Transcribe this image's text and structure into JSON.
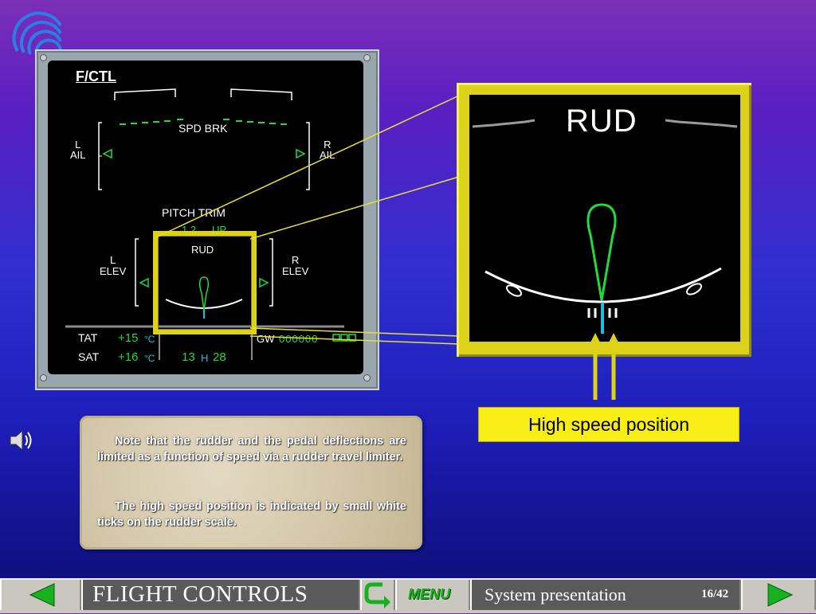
{
  "ecam": {
    "title": "F/CTL",
    "spd_brk": "SPD BRK",
    "l_ail_1": "L",
    "l_ail_2": "AIL",
    "r_ail_1": "R",
    "r_ail_2": "AIL",
    "pitch_trim": "PITCH TRIM",
    "pitch_value": "1.2",
    "pitch_dir": "UP",
    "rud": "RUD",
    "l_elev_1": "L",
    "l_elev_2": "ELEV",
    "r_elev_1": "R",
    "r_elev_2": "ELEV",
    "tat_label": "TAT",
    "tat_value": "+15",
    "tat_unit": "°C",
    "sat_label": "SAT",
    "sat_value": "+16",
    "sat_unit": "°C",
    "time_h": "13",
    "time_sep": "H",
    "time_m": "28",
    "gw_label": "GW",
    "gw_value": "000000"
  },
  "zoom": {
    "rud": "RUD"
  },
  "callout": "High speed position",
  "note": {
    "p1": "Note that the rudder and the pedal deflections are limited as a function of speed via a rudder travel limiter.",
    "p2": "The high speed position is indicated by small white ticks on the rudder scale."
  },
  "footer": {
    "title": "FLIGHT CONTROLS",
    "menu": "MENU",
    "subtitle": "System presentation",
    "page": "16/42"
  },
  "colors": {
    "ecam_green": "#1fdc3a",
    "ecam_cyan": "#18c0d8",
    "frame_yellow": "#dcd21a"
  },
  "icons": {
    "logo": "airbus-swirl-logo",
    "sound": "speaker-icon",
    "prev": "left-arrow-icon",
    "next": "right-arrow-icon",
    "back": "return-arrow-icon"
  }
}
